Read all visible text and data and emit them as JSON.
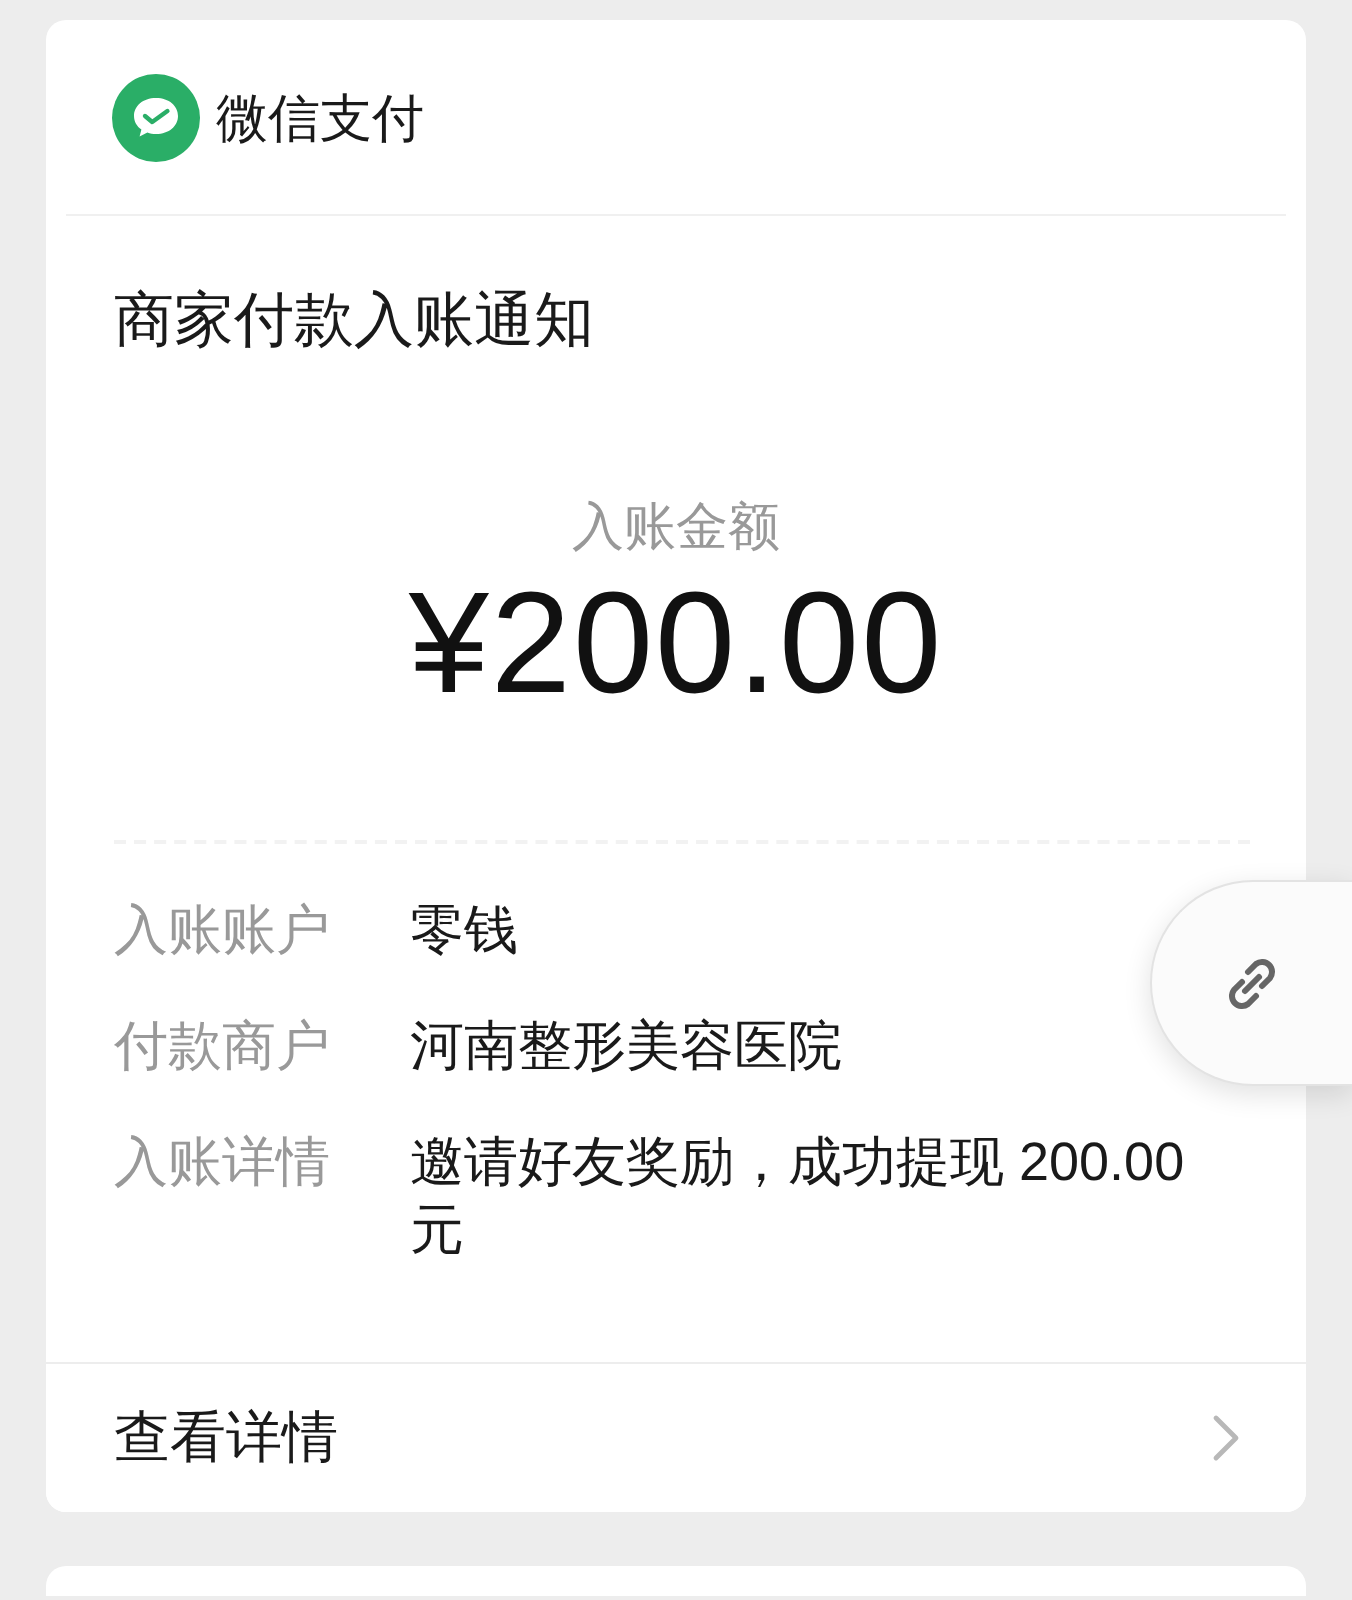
{
  "header": {
    "app_name": "微信支付"
  },
  "title": "商家付款入账通知",
  "amount": {
    "label": "入账金额",
    "value": "¥200.00"
  },
  "details": [
    {
      "label": "入账账户",
      "value": "零钱"
    },
    {
      "label": "付款商户",
      "value": "河南整形美容医院"
    },
    {
      "label": "入账详情",
      "value": "邀请好友奖励，成功提现 200.00元"
    }
  ],
  "footer_link": {
    "label": "查看详情"
  }
}
